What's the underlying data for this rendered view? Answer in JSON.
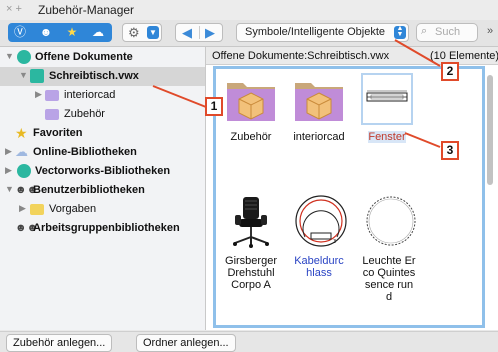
{
  "window": {
    "title": "Zubehör-Manager",
    "close_glyph": "× +"
  },
  "toolbar": {
    "filter_icons": [
      "vectorworks-icon",
      "people-icon",
      "star-icon",
      "cloud-icon"
    ],
    "category_select": "Symbole/Intelligente Objekte",
    "search_placeholder": "Such",
    "more_glyph": "»",
    "accent_color": "#2f86d8"
  },
  "sidebar": {
    "items": [
      {
        "label": "Offene Dokumente",
        "bold": true
      },
      {
        "label": "Schreibtisch.vwx",
        "bold": true,
        "selected": true
      },
      {
        "label": "interiorcad",
        "bold": false
      },
      {
        "label": "Zubehör",
        "bold": false
      },
      {
        "label": "Favoriten",
        "bold": true
      },
      {
        "label": "Online-Bibliotheken",
        "bold": true
      },
      {
        "label": "Vectorworks-Bibliotheken",
        "bold": true
      },
      {
        "label": "Benutzerbibliotheken",
        "bold": true
      },
      {
        "label": "Vorgaben",
        "bold": false
      },
      {
        "label": "Arbeitsgruppenbibliotheken",
        "bold": true
      }
    ]
  },
  "main": {
    "header": "Offene Dokumente:Schreibtisch.vwx",
    "header_count": "(10 Elemente)",
    "items": [
      {
        "label": "Zubehör",
        "color": "#111111"
      },
      {
        "label": "interiorcad",
        "color": "#111111"
      },
      {
        "label": "Fenster",
        "color": "#c0392b"
      },
      {
        "label": "Girsberger Drehstuhl Corpo A",
        "color": "#111111"
      },
      {
        "label": "Kabeldurchlass",
        "color": "#2a44c4"
      },
      {
        "label": "Leuchte Erco Quintessence rund",
        "color": "#111111"
      }
    ]
  },
  "callouts": [
    "1",
    "2",
    "3"
  ],
  "bottom": {
    "new_resource": "Zubehör anlegen...",
    "new_folder": "Ordner anlegen..."
  }
}
